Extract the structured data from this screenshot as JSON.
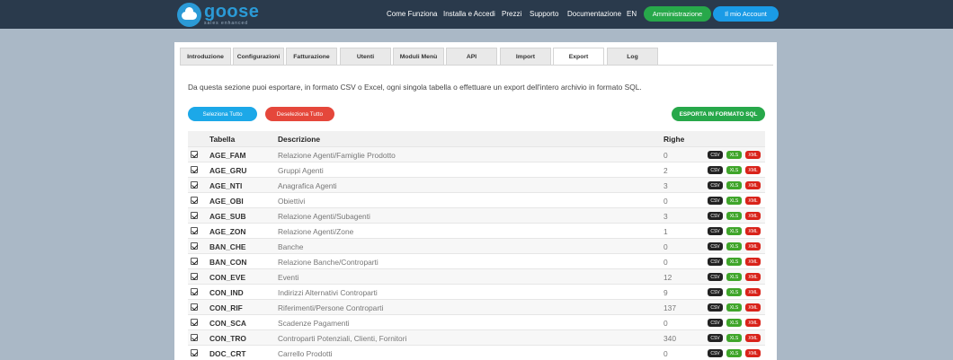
{
  "header": {
    "logo_name": "goose",
    "logo_sub": "sales enhanced",
    "nav": [
      "Come Funziona",
      "Installa e Accedi",
      "Prezzi",
      "Supporto",
      "Documentazione",
      "EN"
    ],
    "admin_label": "Amministrazione",
    "account_label": "Il mio Account",
    "colors": {
      "bar": "#2a3a4c",
      "admin": "#27a84a",
      "account": "#1a9be6"
    }
  },
  "tabs": [
    "Introduzione",
    "Configurazioni",
    "Fatturazione",
    "Utenti",
    "Moduli Menù",
    "API",
    "Import",
    "Export",
    "Log"
  ],
  "active_tab": "Export",
  "intro": "Da questa sezione puoi esportare, in formato CSV o Excel, ogni singola tabella o effettuare un export dell'intero archivio in formato SQL.",
  "buttons": {
    "select_all": "Seleziona Tutto",
    "deselect_all": "Deseleziona Tutto",
    "export_sql": "ESPORTA IN FORMATO SQL"
  },
  "table": {
    "headers": {
      "table": "Tabella",
      "description": "Descrizione",
      "rows": "Righe"
    },
    "badges": {
      "csv": "CSV",
      "xls": "XLS",
      "xml": "XML"
    },
    "rows": [
      {
        "name": "AGE_FAM",
        "desc": "Relazione Agenti/Famiglie Prodotto",
        "rows": "0"
      },
      {
        "name": "AGE_GRU",
        "desc": "Gruppi Agenti",
        "rows": "2"
      },
      {
        "name": "AGE_NTI",
        "desc": "Anagrafica Agenti",
        "rows": "3"
      },
      {
        "name": "AGE_OBI",
        "desc": "Obiettivi",
        "rows": "0"
      },
      {
        "name": "AGE_SUB",
        "desc": "Relazione Agenti/Subagenti",
        "rows": "3"
      },
      {
        "name": "AGE_ZON",
        "desc": "Relazione Agenti/Zone",
        "rows": "1"
      },
      {
        "name": "BAN_CHE",
        "desc": "Banche",
        "rows": "0"
      },
      {
        "name": "BAN_CON",
        "desc": "Relazione Banche/Controparti",
        "rows": "0"
      },
      {
        "name": "CON_EVE",
        "desc": "Eventi",
        "rows": "12"
      },
      {
        "name": "CON_IND",
        "desc": "Indirizzi Alternativi Controparti",
        "rows": "9"
      },
      {
        "name": "CON_RIF",
        "desc": "Riferimenti/Persone Controparti",
        "rows": "137"
      },
      {
        "name": "CON_SCA",
        "desc": "Scadenze Pagamenti",
        "rows": "0"
      },
      {
        "name": "CON_TRO",
        "desc": "Controparti Potenziali, Clienti, Fornitori",
        "rows": "340"
      },
      {
        "name": "DOC_CRT",
        "desc": "Carrello Prodotti",
        "rows": "0"
      }
    ]
  }
}
